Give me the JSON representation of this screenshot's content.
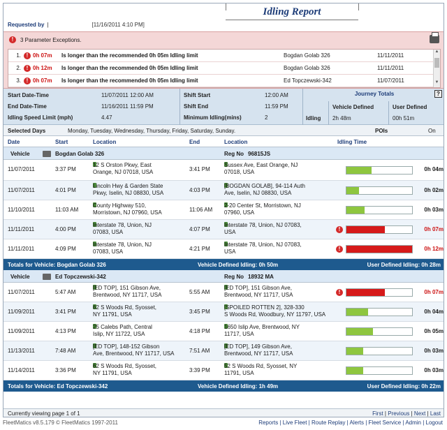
{
  "report": {
    "title": "Idling Report",
    "requested_by_label": "Requested by",
    "requested_by_value": "|",
    "requested_at": "[11/16/2011 4:10 PM]"
  },
  "exceptions": {
    "header": "3 Parameter Exceptions.",
    "rows": [
      {
        "n": "1.",
        "dur": "0h 07m",
        "msg": "Is longer than the recommended 0h 05m Idling limit",
        "vehicle": "Bogdan Golab 326",
        "date": "11/11/2011"
      },
      {
        "n": "2.",
        "dur": "0h 12m",
        "msg": "Is longer than the recommended 0h 05m Idling limit",
        "vehicle": "Bogdan Golab 326",
        "date": "11/11/2011"
      },
      {
        "n": "3.",
        "dur": "0h 07m",
        "msg": "Is longer than the recommended 0h 05m Idling limit",
        "vehicle": "Ed Topczewski-342",
        "date": "11/07/2011"
      }
    ]
  },
  "params": {
    "start_label": "Start Date-Time",
    "start_value": "11/07/2011 12:00 AM",
    "end_label": "End Date-Time",
    "end_value": "11/16/2011 11:59 PM",
    "speed_label": "Idling Speed Limit (mph)",
    "speed_value": "4.47",
    "shift_start_label": "Shift Start",
    "shift_start_value": "12:00 AM",
    "shift_end_label": "Shift End",
    "shift_end_value": "11:59 PM",
    "min_idle_label": "Minimum Idling(mins)",
    "min_idle_value": "2"
  },
  "journey": {
    "title": "Journey Totals",
    "help": "?",
    "col1": "Vehicle Defined",
    "col2": "User Defined",
    "row_label": "Idling",
    "v1": "2h 48m",
    "v2": "00h 51m"
  },
  "selected": {
    "label": "Selected Days",
    "value": "Monday, Tuesday, Wednesday, Thursday, Friday, Saturday, Sunday.",
    "pois_label": "POIs",
    "pois_value": "On"
  },
  "columns": {
    "date": "Date",
    "start": "Start",
    "location": "Location",
    "end": "End",
    "location2": "Location",
    "idling": "Idling Time"
  },
  "vehicles": [
    {
      "label": "Vehicle",
      "name": "Bogdan Golab 326",
      "reg_label": "Reg No",
      "reg": "96815JS",
      "rows": [
        {
          "date": "11/07/2011",
          "start": "3:37 PM",
          "loc1a": "12 S Orston Pkwy, East",
          "loc1b": "Orange, NJ 07018, USA",
          "end": "3:41 PM",
          "loc2a": "Sussex Ave, East Orange, NJ",
          "loc2b": "07018, USA",
          "pct": 0.38,
          "red": false,
          "dur": "0h 04m"
        },
        {
          "date": "11/07/2011",
          "start": "4:01 PM",
          "loc1a": "Lincoln Hwy & Garden State",
          "loc1b": "Pkwy, Iselin, NJ 08830, USA",
          "end": "4:03 PM",
          "loc2a": "[BOGDAN GOLAB], 94-114 Auth",
          "loc2b": "Ave, Iselin, NJ 08830, USA",
          "pct": 0.19,
          "red": false,
          "dur": "0h 02m"
        },
        {
          "date": "11/10/2011",
          "start": "11:03 AM",
          "loc1a": "County Highway 510,",
          "loc1b": "Morristown, NJ 07960, USA",
          "end": "11:06 AM",
          "loc2a": "2-20 Center St, Morristown, NJ",
          "loc2b": "07960, USA",
          "pct": 0.28,
          "red": false,
          "dur": "0h 03m"
        },
        {
          "date": "11/11/2011",
          "start": "4:00 PM",
          "loc1a": "Interstate 78, Union, NJ",
          "loc1b": "07083, USA",
          "end": "4:07 PM",
          "loc2a": "Interstate 78, Union, NJ 07083,",
          "loc2b": "USA",
          "pct": 0.58,
          "red": true,
          "dur": "0h 07m"
        },
        {
          "date": "11/11/2011",
          "start": "4:09 PM",
          "loc1a": "Interstate 78, Union, NJ",
          "loc1b": "07083, USA",
          "end": "4:21 PM",
          "loc2a": "Interstate 78, Union, NJ 07083,",
          "loc2b": "USA",
          "pct": 1.0,
          "red": true,
          "dur": "0h 12m"
        }
      ],
      "total_label": "Totals for Vehicle: Bogdan Golab 326",
      "veh_def": "Vehicle Defined Idling: 0h 50m",
      "user_def": "User Defined Idling: 0h 28m"
    },
    {
      "label": "Vehicle",
      "name": "Ed Topczewski-342",
      "reg_label": "Reg No",
      "reg": "18932 MA",
      "rows": [
        {
          "date": "11/07/2011",
          "start": "5:47 AM",
          "loc1a": "[ED TOP], 151 Gibson Ave,",
          "loc1b": "Brentwood, NY 11717, USA",
          "end": "5:55 AM",
          "loc2a": "[ED TOP], 151 Gibson Ave,",
          "loc2b": "Brentwood, NY 11717, USA",
          "pct": 0.58,
          "red": true,
          "dur": "0h 07m"
        },
        {
          "date": "11/09/2011",
          "start": "3:41 PM",
          "loc1a": "62 S Woods Rd, Syosset,",
          "loc1b": "NY 11791, USA",
          "end": "3:45 PM",
          "loc2a": "[SPOILED ROTTEN 2], 328-330",
          "loc2b": "S Woods Rd, Woodbury, NY 11797, USA",
          "pct": 0.33,
          "red": false,
          "dur": "0h 04m"
        },
        {
          "date": "11/09/2011",
          "start": "4:13 PM",
          "loc1a": "25 Calebs Path, Central",
          "loc1b": "Islip, NY 11722, USA",
          "end": "4:18 PM",
          "loc2a": "1650 Islip Ave, Brentwood, NY",
          "loc2b": "11717, USA",
          "pct": 0.4,
          "red": false,
          "dur": "0h 05m"
        },
        {
          "date": "11/13/2011",
          "start": "7:48 AM",
          "loc1a": "[ED TOP], 148-152 Gibson",
          "loc1b": "Ave, Brentwood, NY 11717, USA",
          "end": "7:51 AM",
          "loc2a": "[ED TOP], 149 Gibson Ave,",
          "loc2b": "Brentwood, NY 11717, USA",
          "pct": 0.25,
          "red": false,
          "dur": "0h 03m"
        },
        {
          "date": "11/14/2011",
          "start": "3:36 PM",
          "loc1a": "62 S Woods Rd, Syosset,",
          "loc1b": "NY 11791, USA",
          "end": "3:39 PM",
          "loc2a": "52 S Woods Rd, Syosset, NY",
          "loc2b": "11791, USA",
          "pct": 0.25,
          "red": false,
          "dur": "0h 03m"
        }
      ],
      "total_label": "Totals for Vehicle: Ed Topczewski-342",
      "veh_def": "Vehicle Defined Idling: 1h 49m",
      "user_def": "User Defined Idling: 0h 22m"
    }
  ],
  "footer": {
    "viewing": "Currently viewing page 1 of 1",
    "first": "First",
    "previous": "Previous",
    "next": "Next",
    "last": "Last"
  },
  "copyright": "FleetMatics v8.5.179 © FleetMatics 1997-2011",
  "nav": [
    "Reports",
    "Live Fleet",
    "Route Replay",
    "Alerts",
    "Fleet Service",
    "Admin",
    "Logout"
  ],
  "colors": {
    "accent": "#1e5a8e",
    "exception": "#d61a1a",
    "ok": "#8ec63f"
  }
}
